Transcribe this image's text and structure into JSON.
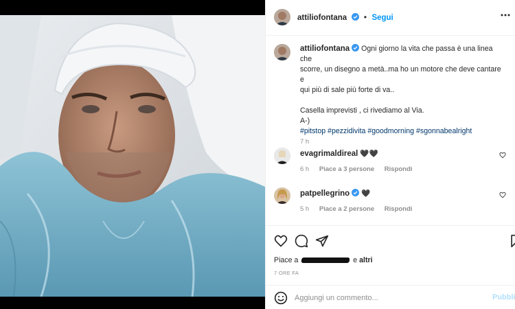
{
  "post": {
    "username": "attiliofontana",
    "follow_label": "Segui",
    "separator": "•",
    "caption": {
      "line1": "Ogni giorno la vita che passa è una linea che",
      "line2": "scorre, un disegno a metà..ma ho un motore che deve cantare e",
      "line3": "qui più di sale più forte di va..",
      "line4": "Casella imprevisti , ci rivediamo al Via.",
      "line5": "A-)",
      "hashtags": "#pitstop #pezzidivita #goodmorning #sgonnabealright",
      "time": "7 h"
    }
  },
  "comments": [
    {
      "username": "evagrimaldireal",
      "text": "🖤🖤",
      "time": "6 h",
      "likes": "Piace a 3 persone",
      "reply": "Rispondi"
    },
    {
      "username": "patpellegrino",
      "text": "🖤",
      "time": "5 h",
      "likes": "Piace a 2 persone",
      "reply": "Rispondi"
    }
  ],
  "footer": {
    "likes_prefix": "Piace a",
    "likes_suffix_and": "e",
    "likes_others": "altri",
    "post_time": "7 ORE FA",
    "comment_placeholder": "Aggiungi un commento...",
    "publish_label": "Pubblica"
  },
  "colors": {
    "accent": "#0095f6",
    "verified": "#3897f0",
    "hashtag": "#00376b",
    "muted": "#8e8e8e",
    "publish_disabled": "#b2dffc"
  },
  "icons": [
    "more-icon",
    "verified-icon",
    "heart-icon",
    "comment-icon",
    "share-icon",
    "bookmark-icon",
    "emoji-icon"
  ]
}
